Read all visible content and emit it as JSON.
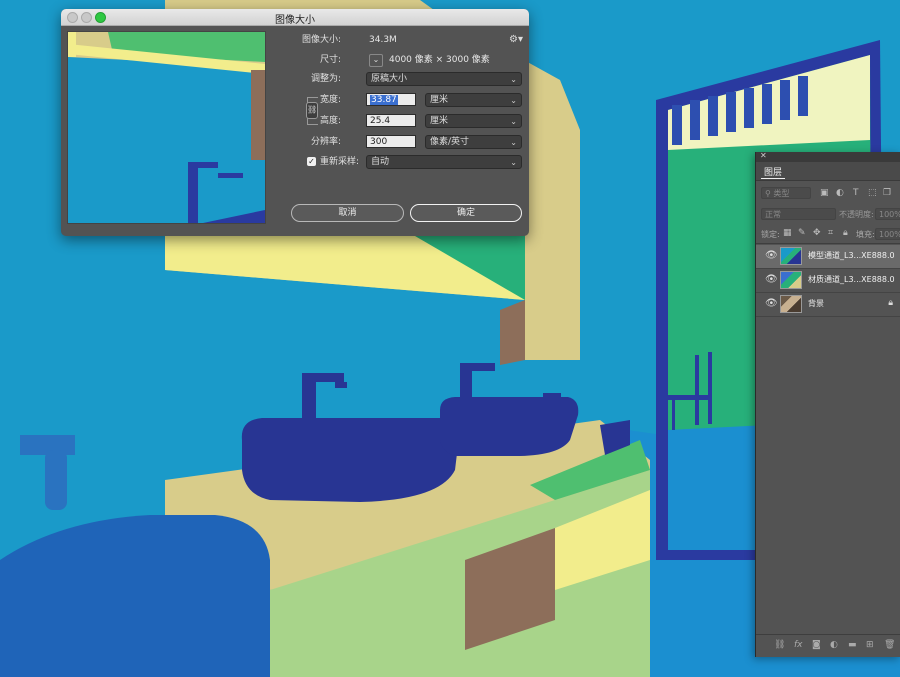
{
  "dialog": {
    "title": "图像大小",
    "image_size_label": "图像大小:",
    "image_size_value": "34.3M",
    "dimensions_label": "尺寸:",
    "dimensions_value": "4000 像素 × 3000 像素",
    "fit_to_label": "调整为:",
    "fit_to_value": "原稿大小",
    "width_label": "宽度:",
    "width_value": "33.87",
    "width_unit": "厘米",
    "height_label": "高度:",
    "height_value": "25.4",
    "height_unit": "厘米",
    "resolution_label": "分辨率:",
    "resolution_value": "300",
    "resolution_unit": "像素/英寸",
    "resample_label": "重新采样:",
    "resample_checked": true,
    "resample_value": "自动",
    "cancel_label": "取消",
    "ok_label": "确定"
  },
  "layers_panel": {
    "tab_label": "图层",
    "filter_placeholder": "类型",
    "blend_mode": "正常",
    "opacity_label": "不透明度:",
    "opacity_value": "100%",
    "lock_label": "锁定:",
    "fill_label": "填充:",
    "fill_value": "100%",
    "layers": [
      {
        "name": "模型通道_L3...XE888.0",
        "active": true,
        "locked": false
      },
      {
        "name": "材质通道_L3...XE888.0",
        "active": false,
        "locked": false
      },
      {
        "name": "背景",
        "active": false,
        "locked": true
      }
    ]
  },
  "colors": {
    "background_blue": "#1a9ac9",
    "dark_blue": "#283593",
    "cream": "#d8cc8a",
    "green": "#27b07a",
    "light_green": "#a8d48a",
    "brown": "#8d6e5a"
  }
}
